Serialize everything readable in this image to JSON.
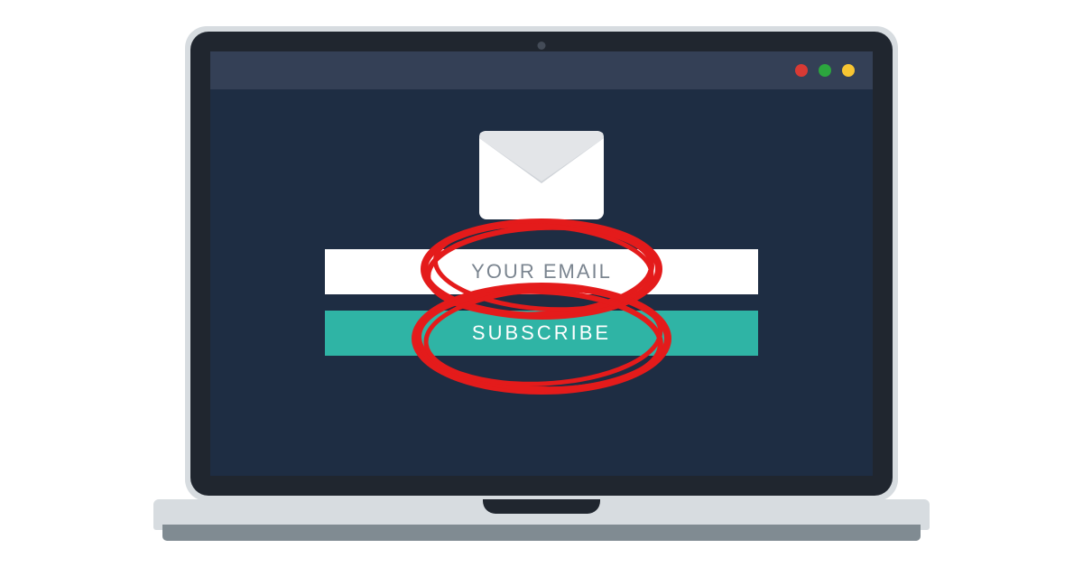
{
  "form": {
    "email_placeholder": "YOUR EMAIL",
    "subscribe_label": "SUBSCRIBE"
  },
  "colors": {
    "screen_bg": "#1e2d43",
    "accent": "#2fb4a5",
    "annotation": "#e41b1b"
  }
}
